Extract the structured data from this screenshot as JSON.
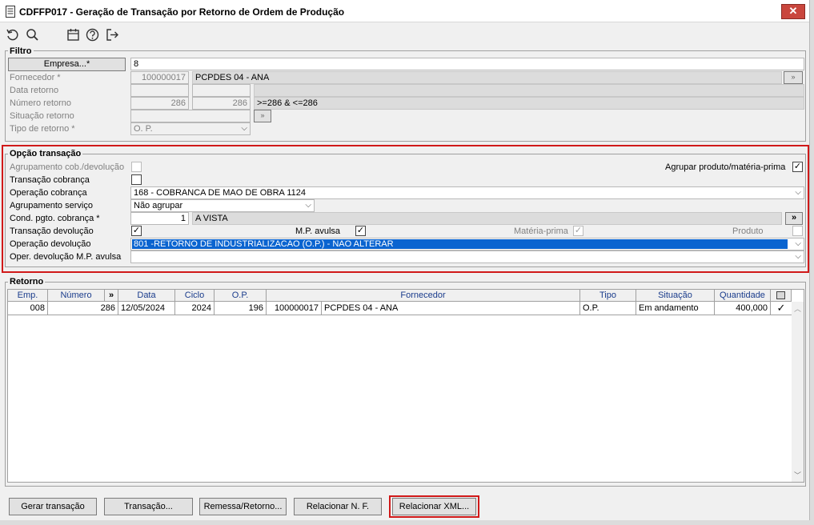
{
  "window": {
    "title": "CDFFP017 - Geração de Transação por Retorno de Ordem de Produção",
    "close_glyph": "✕"
  },
  "filtro": {
    "group_label": "Filtro",
    "empresa_button": "Empresa...*",
    "empresa_value": "8",
    "fornecedor_label": "Fornecedor *",
    "fornecedor_code": "100000017",
    "fornecedor_name": "PCPDES 04 - ANA",
    "data_retorno_label": "Data retorno",
    "numero_retorno_label": "Número retorno",
    "numero_de": "286",
    "numero_ate": "286",
    "numero_expr": ">=286 & <=286",
    "situacao_label": "Situação retorno",
    "tipo_label": "Tipo de retorno *",
    "tipo_value": "O. P."
  },
  "opcao": {
    "group_label": "Opção transação",
    "agrupamento_label": "Agrupamento cob./devolução",
    "agrupar_produto_label": "Agrupar produto/matéria-prima",
    "transacao_cobranca_label": "Transação cobrança",
    "operacao_cobranca_label": "Operação cobrança",
    "operacao_cobranca_value": "168 - COBRANCA DE MAO DE OBRA 1124",
    "agrupamento_servico_label": "Agrupamento serviço",
    "agrupamento_servico_value": "Não agrupar",
    "cond_pgto_label": "Cond. pgto. cobrança *",
    "cond_pgto_code": "1",
    "cond_pgto_name": "A VISTA",
    "transacao_devolucao_label": "Transação devolução",
    "mp_avulsa_label": "M.P. avulsa",
    "materia_prima_label": "Matéria-prima",
    "produto_label": "Produto",
    "operacao_devolucao_label": "Operação devolução",
    "operacao_devolucao_value": "801 -RETORNO DE INDUSTRIALIZACAO (O.P.) - NAO ALTERAR",
    "oper_dev_mp_label": "Oper. devolução M.P. avulsa"
  },
  "retorno": {
    "group_label": "Retorno",
    "columns": [
      "Emp.",
      "Número",
      "»",
      "Data",
      "Ciclo",
      "O.P.",
      "Fornecedor",
      "Tipo",
      "Situação",
      "Quantidade"
    ],
    "row": {
      "emp": "008",
      "numero": "286",
      "data": "12/05/2024",
      "ciclo": "2024",
      "op": "196",
      "fornecedor_code": "100000017",
      "fornecedor_name": "PCPDES 04 - ANA",
      "tipo": "O.P.",
      "situacao": "Em andamento",
      "quantidade": "400,000",
      "check": "✓"
    }
  },
  "buttons": {
    "gerar": "Gerar transação",
    "transacao": "Transação...",
    "remessa": "Remessa/Retorno...",
    "relacionar_nf": "Relacionar N. F.",
    "relacionar_xml": "Relacionar XML..."
  },
  "glyphs": {
    "check": "✓",
    "dropdown": "⌵",
    "more": "»",
    "expand": "»"
  },
  "colors": {
    "selection": "#0a64d0",
    "highlight_border": "#d01919",
    "header_text": "#1a3c8c"
  }
}
